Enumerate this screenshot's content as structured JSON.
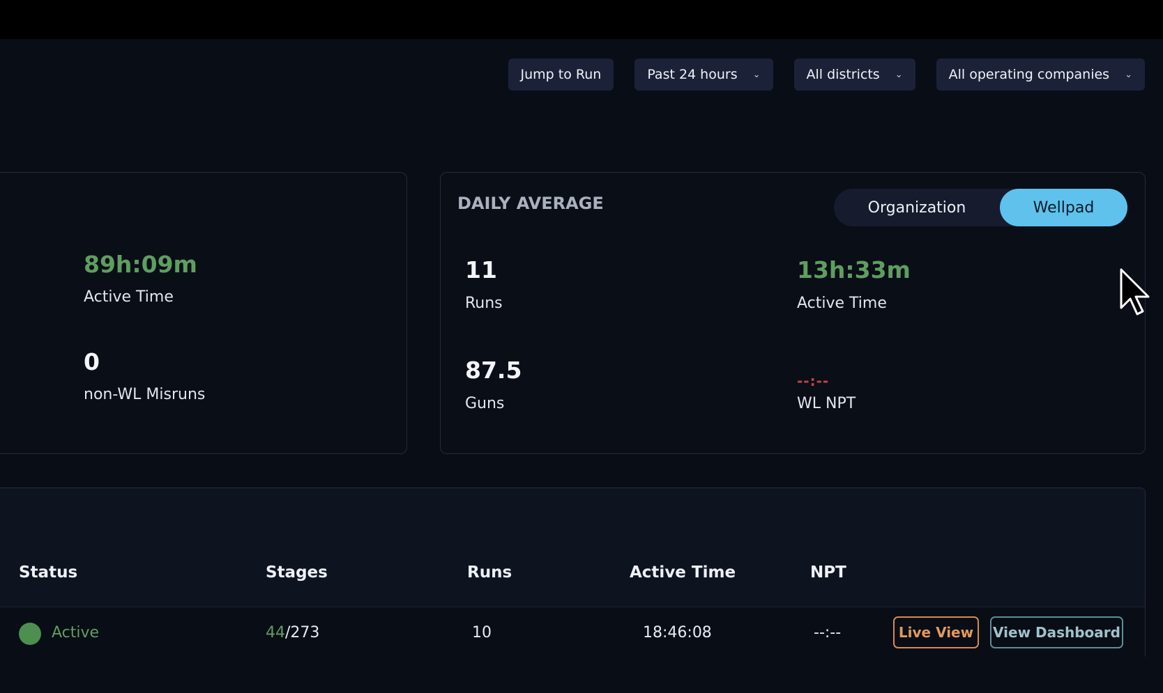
{
  "filters": {
    "jump_label": "Jump to Run",
    "time_range": "Past 24 hours",
    "district": "All districts",
    "company": "All operating companies"
  },
  "summary": {
    "active_time_value": "89h:09m",
    "active_time_label": "Active Time",
    "misruns_value": "0",
    "misruns_label": "non-WL Misruns"
  },
  "daily_average": {
    "title": "DAILY AVERAGE",
    "toggle": {
      "org": "Organization",
      "wellpad": "Wellpad",
      "selected": "Wellpad"
    },
    "runs_value": "11",
    "runs_label": "Runs",
    "active_time_value": "13h:33m",
    "active_time_label": "Active Time",
    "guns_value": "87.5",
    "guns_label": "Guns",
    "wl_npt_value": "--:--",
    "wl_npt_label": "WL NPT"
  },
  "table": {
    "headers": {
      "status": "Status",
      "stages": "Stages",
      "runs": "Runs",
      "active_time": "Active Time",
      "npt": "NPT"
    },
    "row": {
      "status": "Active",
      "stages_done": "44",
      "stages_total": "/273",
      "runs": "10",
      "active_time": "18:46:08",
      "npt": "--:--",
      "live_view": "Live View",
      "view_dashboard": "View Dashboard"
    }
  },
  "colors": {
    "accent_green": "#5e9e60",
    "toggle_active": "#5ec2ec",
    "live_view": "#e39a5d",
    "dashboard": "#9fc3cc",
    "npt_red": "#c0444a"
  }
}
